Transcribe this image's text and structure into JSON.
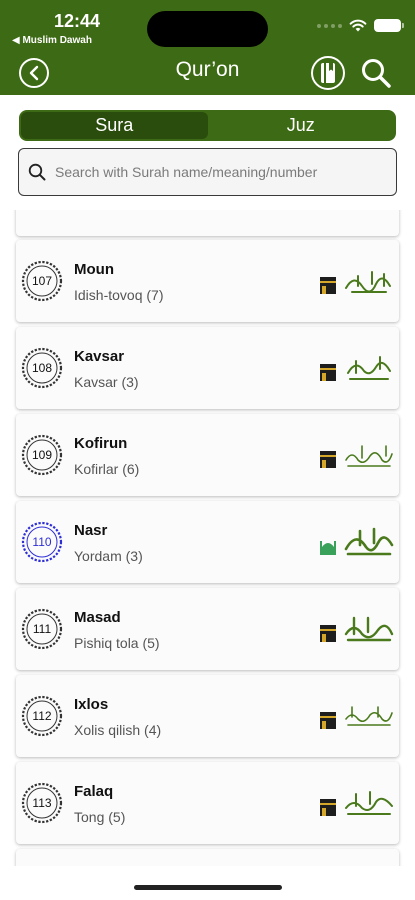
{
  "status": {
    "time": "12:44",
    "back_app": "◀ Muslim Dawah"
  },
  "header": {
    "title": "Qur’on"
  },
  "tabs": [
    {
      "label": "Sura",
      "active": true
    },
    {
      "label": "Juz",
      "active": false
    }
  ],
  "search": {
    "placeholder": "Search with Surah name/meaning/number"
  },
  "surahs": [
    {
      "number": "107",
      "name": "Moun",
      "meaning": "Idish-tovoq (7)",
      "revelation": "makkah"
    },
    {
      "number": "108",
      "name": "Kavsar",
      "meaning": "Kavsar (3)",
      "revelation": "makkah"
    },
    {
      "number": "109",
      "name": "Kofirun",
      "meaning": "Kofirlar (6)",
      "revelation": "makkah"
    },
    {
      "number": "110",
      "name": "Nasr",
      "meaning": "Yordam (3)",
      "revelation": "madinah"
    },
    {
      "number": "111",
      "name": "Masad",
      "meaning": "Pishiq tola (5)",
      "revelation": "makkah"
    },
    {
      "number": "112",
      "name": "Ixlos",
      "meaning": "Xolis qilish (4)",
      "revelation": "makkah"
    },
    {
      "number": "113",
      "name": "Falaq",
      "meaning": "Tong (5)",
      "revelation": "makkah"
    }
  ],
  "colors": {
    "primary": "#3d6a14",
    "primary_dark": "#2a4c0c",
    "medinah_ring": "#2e2ed6",
    "arabic_green": "#4a7a1c"
  }
}
